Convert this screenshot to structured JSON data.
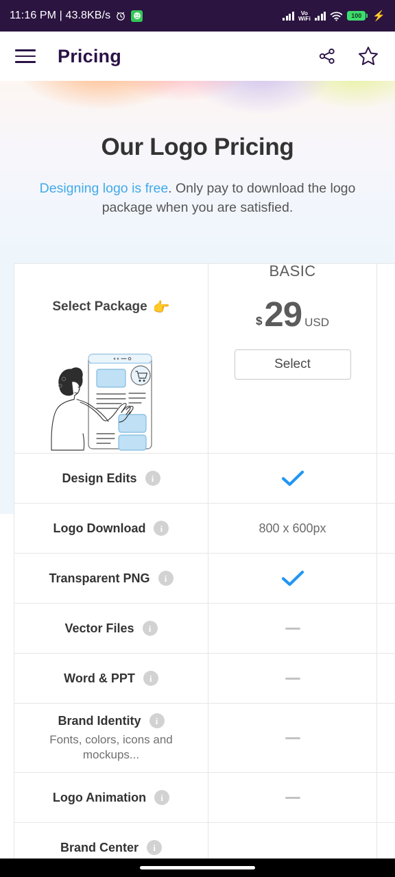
{
  "statusbar": {
    "time_network": "11:16 PM | 43.8KB/s",
    "alarm_icon": "alarm-clock-icon",
    "app_icon": "green-app-icon",
    "signal_icon": "signal-bars-icon",
    "volte_line1": "Vo",
    "volte_line2": "WiFi",
    "signal2_icon": "signal-bars-icon",
    "wifi_icon": "wifi-icon",
    "battery_percent": "100",
    "charging_icon": "bolt-icon",
    "background_color": "#2b1440"
  },
  "appbar": {
    "menu_icon": "hamburger-menu-icon",
    "title": "Pricing",
    "share_icon": "share-icon",
    "favorite_icon": "star-icon"
  },
  "hero": {
    "title": "Our Logo Pricing",
    "subtitle_highlight": "Designing logo is free",
    "subtitle_rest": ". Only pay to download the logo package when you are satisfied.",
    "highlight_color": "#41aaea"
  },
  "table": {
    "header": {
      "feature_col_label": "Select Package",
      "feature_col_emoji": "👉",
      "illustration": "person-selecting-package-illustration",
      "packages": [
        {
          "name": "BASIC",
          "currency": "$",
          "amount": "29",
          "unit": "USD",
          "cta": "Select"
        }
      ]
    },
    "info_icon": "info-icon",
    "check_icon": "check-icon",
    "dash_icon": "dash-icon",
    "accent_check_color": "#2196f3",
    "rows": [
      {
        "name": "Design Edits",
        "sub": "",
        "basic_type": "check",
        "basic_value": ""
      },
      {
        "name": "Logo Download",
        "sub": "",
        "basic_type": "text",
        "basic_value": "800 x 600px"
      },
      {
        "name": "Transparent PNG",
        "sub": "",
        "basic_type": "check",
        "basic_value": ""
      },
      {
        "name": "Vector Files",
        "sub": "",
        "basic_type": "dash",
        "basic_value": ""
      },
      {
        "name": "Word & PPT",
        "sub": "",
        "basic_type": "dash",
        "basic_value": ""
      },
      {
        "name": "Brand Identity",
        "sub": "Fonts, colors, icons and mockups...",
        "basic_type": "dash",
        "basic_value": ""
      },
      {
        "name": "Logo Animation",
        "sub": "",
        "basic_type": "dash",
        "basic_value": ""
      },
      {
        "name": "Brand Center",
        "sub": "",
        "basic_type": "none",
        "basic_value": ""
      }
    ]
  },
  "navbar": {
    "home_pill": "home-indicator"
  }
}
